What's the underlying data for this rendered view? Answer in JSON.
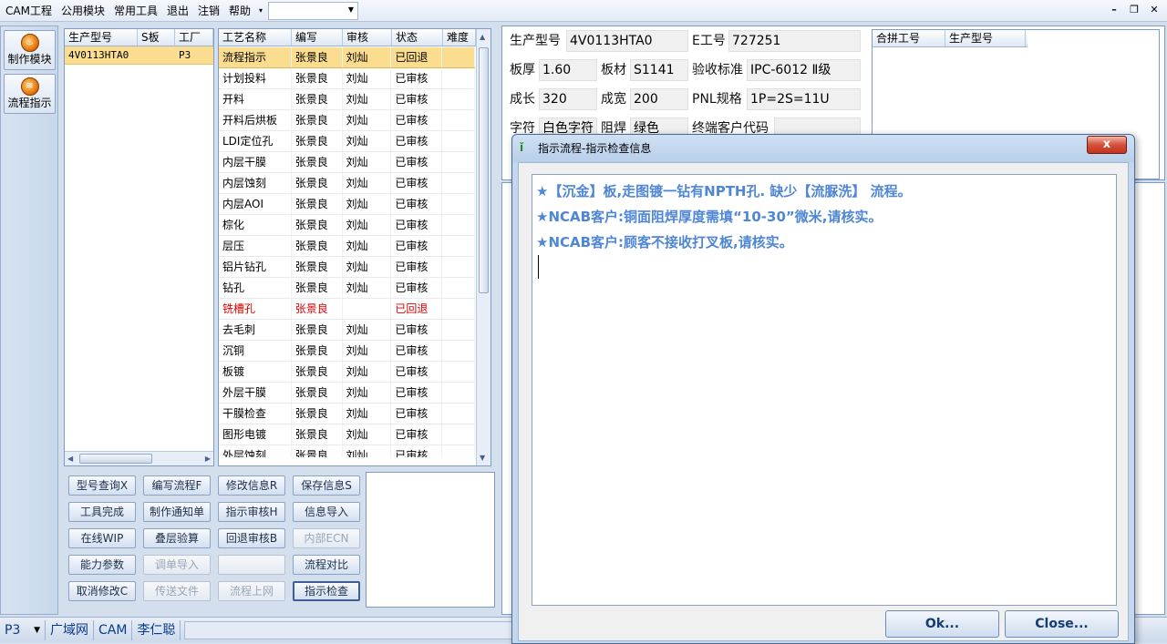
{
  "menu": {
    "items": [
      "CAM工程",
      "公用模块",
      "常用工具",
      "退出",
      "注销",
      "帮助"
    ],
    "more_arrow": "▾",
    "combo_value": ""
  },
  "toolstrip": {
    "buttons": [
      {
        "label": "制作模块",
        "icon": "flame-icon"
      },
      {
        "label": "流程指示",
        "icon": "flow-icon"
      }
    ]
  },
  "model_list": {
    "headers": [
      "生产型号",
      "S板",
      "工厂"
    ],
    "rows": [
      {
        "model": "4V0113HTA0",
        "s": "",
        "factory": "P3"
      }
    ]
  },
  "process_grid": {
    "headers": [
      "工艺名称",
      "编写",
      "审核",
      "状态",
      "难度"
    ],
    "rows": [
      {
        "name": "流程指示",
        "writer": "张景良",
        "reviewer": "刘灿",
        "status": "已回退",
        "diff": "",
        "selected": true
      },
      {
        "name": "计划投料",
        "writer": "张景良",
        "reviewer": "刘灿",
        "status": "已审核",
        "diff": ""
      },
      {
        "name": "开料",
        "writer": "张景良",
        "reviewer": "刘灿",
        "status": "已审核",
        "diff": ""
      },
      {
        "name": "开料后烘板",
        "writer": "张景良",
        "reviewer": "刘灿",
        "status": "已审核",
        "diff": ""
      },
      {
        "name": "LDI定位孔",
        "writer": "张景良",
        "reviewer": "刘灿",
        "status": "已审核",
        "diff": ""
      },
      {
        "name": "内层干膜",
        "writer": "张景良",
        "reviewer": "刘灿",
        "status": "已审核",
        "diff": ""
      },
      {
        "name": "内层蚀刻",
        "writer": "张景良",
        "reviewer": "刘灿",
        "status": "已审核",
        "diff": ""
      },
      {
        "name": "内层AOI",
        "writer": "张景良",
        "reviewer": "刘灿",
        "status": "已审核",
        "diff": ""
      },
      {
        "name": "棕化",
        "writer": "张景良",
        "reviewer": "刘灿",
        "status": "已审核",
        "diff": ""
      },
      {
        "name": "层压",
        "writer": "张景良",
        "reviewer": "刘灿",
        "status": "已审核",
        "diff": ""
      },
      {
        "name": "铝片钻孔",
        "writer": "张景良",
        "reviewer": "刘灿",
        "status": "已审核",
        "diff": ""
      },
      {
        "name": "钻孔",
        "writer": "张景良",
        "reviewer": "刘灿",
        "status": "已审核",
        "diff": ""
      },
      {
        "name": "铣槽孔",
        "writer": "张景良",
        "reviewer": "",
        "status": "已回退",
        "diff": "",
        "alert": true
      },
      {
        "name": "去毛刺",
        "writer": "张景良",
        "reviewer": "刘灿",
        "status": "已审核",
        "diff": ""
      },
      {
        "name": "沉铜",
        "writer": "张景良",
        "reviewer": "刘灿",
        "status": "已审核",
        "diff": ""
      },
      {
        "name": "板镀",
        "writer": "张景良",
        "reviewer": "刘灿",
        "status": "已审核",
        "diff": ""
      },
      {
        "name": "外层干膜",
        "writer": "张景良",
        "reviewer": "刘灿",
        "status": "已审核",
        "diff": ""
      },
      {
        "name": "干膜检查",
        "writer": "张景良",
        "reviewer": "刘灿",
        "status": "已审核",
        "diff": ""
      },
      {
        "name": "图形电镀",
        "writer": "张景良",
        "reviewer": "刘灿",
        "status": "已审核",
        "diff": ""
      },
      {
        "name": "外层蚀刻",
        "writer": "张景良",
        "reviewer": "刘灿",
        "status": "已审核",
        "diff": ""
      }
    ]
  },
  "actions": [
    [
      {
        "label": "型号查询X"
      },
      {
        "label": "编写流程F"
      },
      {
        "label": "修改信息R"
      },
      {
        "label": "保存信息S"
      }
    ],
    [
      {
        "label": "工具完成"
      },
      {
        "label": "制作通知单"
      },
      {
        "label": "指示审核H"
      },
      {
        "label": "信息导入"
      }
    ],
    [
      {
        "label": "在线WIP"
      },
      {
        "label": "叠层验算"
      },
      {
        "label": "回退审核B"
      },
      {
        "label": "内部ECN",
        "disabled": true
      }
    ],
    [
      {
        "label": "能力参数"
      },
      {
        "label": "调单导入",
        "disabled": true
      },
      {
        "label": "",
        "disabled": true
      },
      {
        "label": "流程对比"
      }
    ],
    [
      {
        "label": "取消修改C"
      },
      {
        "label": "传送文件",
        "disabled": true
      },
      {
        "label": "流程上网",
        "disabled": true
      },
      {
        "label": "指示检查",
        "focused": true
      }
    ]
  ],
  "info": {
    "model_label": "生产型号",
    "model_value": "4V0113HTA0",
    "e_label": "E工号",
    "e_value": "727251",
    "thick_label": "板厚",
    "thick_value": "1.60",
    "material_label": "板材",
    "material_value": "S1141",
    "std_label": "验收标准",
    "std_value": "IPC-6012 Ⅱ级",
    "len_label": "成长",
    "len_value": "320",
    "wid_label": "成宽",
    "wid_value": "200",
    "pnl_label": "PNL规格",
    "pnl_value": "1P=2S=11U",
    "char_label": "字符",
    "char_value": "白色字符",
    "mask_label": "阻焊",
    "mask_value": "绿色",
    "cust_label": "终端客户代码",
    "cust_value": "",
    "combine_headers": [
      "合拼工号",
      "生产型号"
    ]
  },
  "statusbar": {
    "factory": "P3",
    "network": "广域网",
    "dept": "CAM",
    "user": "李仁聪"
  },
  "dialog": {
    "title": "指示流程-指示检查信息",
    "close_label": "x",
    "messages": [
      "★【沉金】板,走图镀一钻有NPTH孔. 缺少【流脲洗】 流程。",
      "★NCAB客户:铜面阻焊厚度需填“10-30”微米,请核实。",
      "★NCAB客户:顾客不接收打叉板,请核实。"
    ],
    "ok_label": "Ok...",
    "close_button_label": "Close..."
  }
}
